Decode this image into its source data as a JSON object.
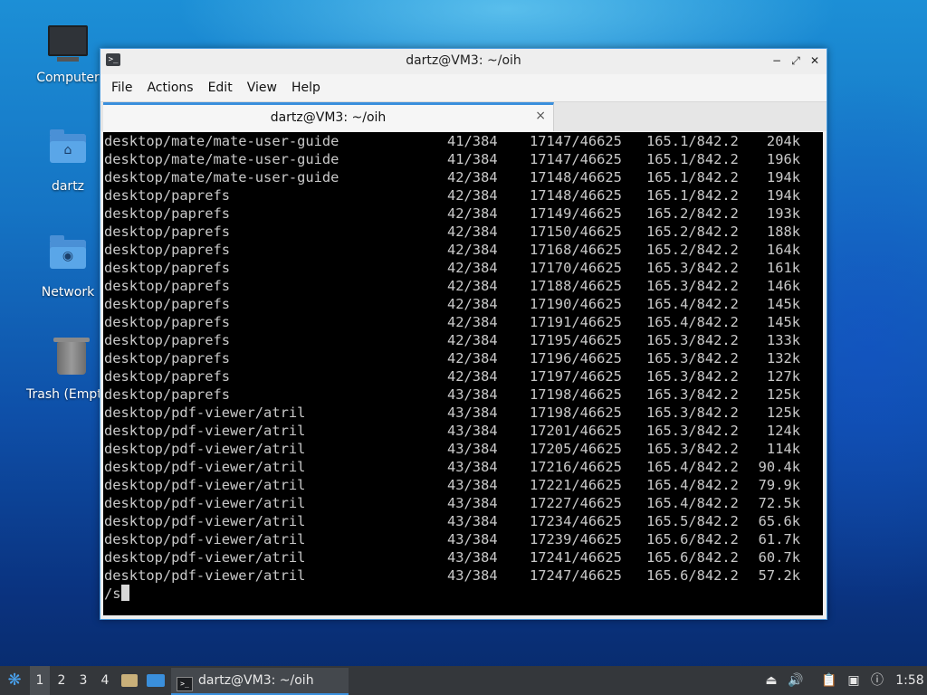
{
  "desktop": {
    "icons": [
      {
        "label": "Computer"
      },
      {
        "label": "dartz"
      },
      {
        "label": "Network"
      },
      {
        "label": "Trash (Empty)"
      }
    ]
  },
  "window": {
    "title": "dartz@VM3: ~/oih",
    "controls": {
      "minimize": "−",
      "maximize": "⤢",
      "close": "✕"
    },
    "menu": [
      "File",
      "Actions",
      "Edit",
      "View",
      "Help"
    ],
    "tab": {
      "label": "dartz@VM3: ~/oih",
      "close": "×"
    }
  },
  "terminal": {
    "lines": [
      [
        "desktop/mate/mate-user-guide",
        "41/384",
        "17147/46625",
        "165.1/842.2",
        "204k"
      ],
      [
        "desktop/mate/mate-user-guide",
        "41/384",
        "17147/46625",
        "165.1/842.2",
        "196k"
      ],
      [
        "desktop/mate/mate-user-guide",
        "42/384",
        "17148/46625",
        "165.1/842.2",
        "194k"
      ],
      [
        "desktop/paprefs",
        "42/384",
        "17148/46625",
        "165.1/842.2",
        "194k"
      ],
      [
        "desktop/paprefs",
        "42/384",
        "17149/46625",
        "165.2/842.2",
        "193k"
      ],
      [
        "desktop/paprefs",
        "42/384",
        "17150/46625",
        "165.2/842.2",
        "188k"
      ],
      [
        "desktop/paprefs",
        "42/384",
        "17168/46625",
        "165.2/842.2",
        "164k"
      ],
      [
        "desktop/paprefs",
        "42/384",
        "17170/46625",
        "165.3/842.2",
        "161k"
      ],
      [
        "desktop/paprefs",
        "42/384",
        "17188/46625",
        "165.3/842.2",
        "146k"
      ],
      [
        "desktop/paprefs",
        "42/384",
        "17190/46625",
        "165.4/842.2",
        "145k"
      ],
      [
        "desktop/paprefs",
        "42/384",
        "17191/46625",
        "165.4/842.2",
        "145k"
      ],
      [
        "desktop/paprefs",
        "42/384",
        "17195/46625",
        "165.3/842.2",
        "133k"
      ],
      [
        "desktop/paprefs",
        "42/384",
        "17196/46625",
        "165.3/842.2",
        "132k"
      ],
      [
        "desktop/paprefs",
        "42/384",
        "17197/46625",
        "165.3/842.2",
        "127k"
      ],
      [
        "desktop/paprefs",
        "43/384",
        "17198/46625",
        "165.3/842.2",
        "125k"
      ],
      [
        "desktop/pdf-viewer/atril",
        "43/384",
        "17198/46625",
        "165.3/842.2",
        "125k"
      ],
      [
        "desktop/pdf-viewer/atril",
        "43/384",
        "17201/46625",
        "165.3/842.2",
        "124k"
      ],
      [
        "desktop/pdf-viewer/atril",
        "43/384",
        "17205/46625",
        "165.3/842.2",
        "114k"
      ],
      [
        "desktop/pdf-viewer/atril",
        "43/384",
        "17216/46625",
        "165.4/842.2",
        "90.4k"
      ],
      [
        "desktop/pdf-viewer/atril",
        "43/384",
        "17221/46625",
        "165.4/842.2",
        "79.9k"
      ],
      [
        "desktop/pdf-viewer/atril",
        "43/384",
        "17227/46625",
        "165.4/842.2",
        "72.5k"
      ],
      [
        "desktop/pdf-viewer/atril",
        "43/384",
        "17234/46625",
        "165.5/842.2",
        "65.6k"
      ],
      [
        "desktop/pdf-viewer/atril",
        "43/384",
        "17239/46625",
        "165.6/842.2",
        "61.7k"
      ],
      [
        "desktop/pdf-viewer/atril",
        "43/384",
        "17241/46625",
        "165.6/842.2",
        "60.7k"
      ],
      [
        "desktop/pdf-viewer/atril",
        "43/384",
        "17247/46625",
        "165.6/842.2",
        "57.2k"
      ]
    ],
    "prompt": "/s"
  },
  "taskbar": {
    "workspaces": [
      "1",
      "2",
      "3",
      "4"
    ],
    "active_workspace": "1",
    "task_label": "dartz@VM3: ~/oih",
    "clock": "1:58"
  },
  "colors": {
    "accent": "#3a8fdc",
    "terminal_bg": "#000000",
    "terminal_fg": "#c9c9c9",
    "panel": "#34373b"
  }
}
